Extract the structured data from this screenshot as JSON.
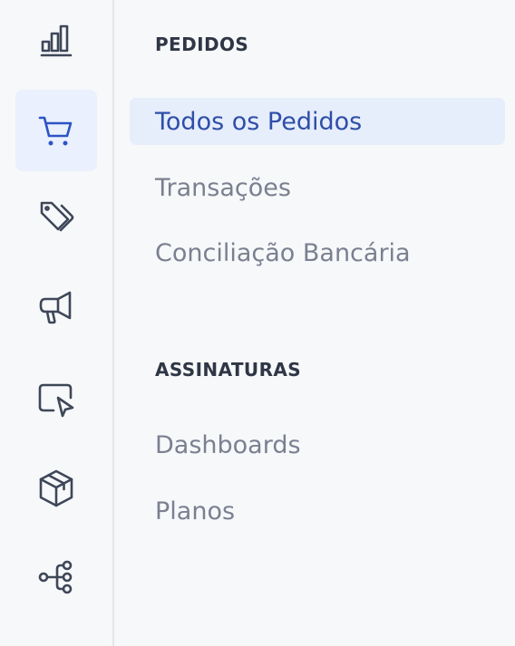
{
  "rail": {
    "icons": [
      {
        "name": "analytics-icon",
        "active": false
      },
      {
        "name": "shopping-cart-icon",
        "active": true
      },
      {
        "name": "tags-icon",
        "active": false
      },
      {
        "name": "megaphone-icon",
        "active": false
      },
      {
        "name": "cursor-window-icon",
        "active": false
      },
      {
        "name": "package-box-icon",
        "active": false
      },
      {
        "name": "workflow-nodes-icon",
        "active": false
      }
    ]
  },
  "menu": {
    "sections": [
      {
        "title": "PEDIDOS",
        "items": [
          {
            "label": "Todos os Pedidos",
            "active": true
          },
          {
            "label": "Transações",
            "active": false
          },
          {
            "label": "Conciliação Bancária",
            "active": false
          }
        ]
      },
      {
        "title": "ASSINATURAS",
        "items": [
          {
            "label": "Dashboards",
            "active": false
          },
          {
            "label": "Planos",
            "active": false
          }
        ]
      }
    ]
  },
  "colors": {
    "background": "#f7f8fa",
    "accent": "#2e4ea8",
    "active_background": "#e6edfb",
    "muted_text": "#7a8090",
    "heading_text": "#2f3645",
    "icon": "#3e4758"
  }
}
